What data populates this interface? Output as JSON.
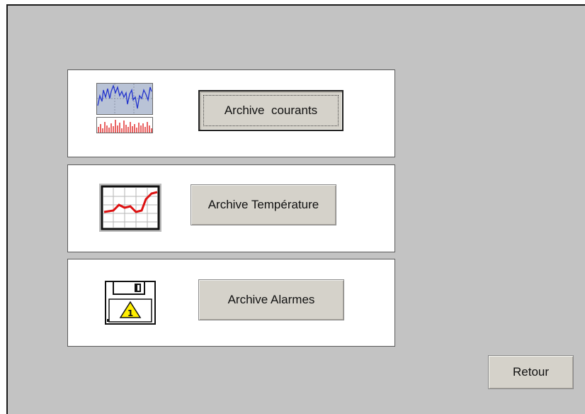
{
  "buttons": {
    "courants": "Archive  courants",
    "temperature": "Archive Température",
    "alarmes": "Archive Alarmes",
    "retour": "Retour"
  },
  "icons": {
    "courants": "current-archive-chart-icon",
    "temperature": "temperature-trend-chart-icon",
    "alarmes": "alarm-floppy-disk-icon"
  },
  "colors": {
    "background": "#c3c3c3",
    "panel": "#ffffff",
    "button": "#d5d2ca",
    "chart_blue": "#2233cc",
    "chart_red": "#dd1111",
    "warning_yellow": "#ffee00"
  }
}
